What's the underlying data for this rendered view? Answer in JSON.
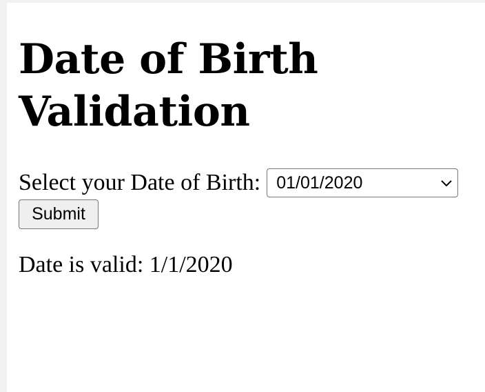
{
  "page": {
    "title": "Date of Birth Validation"
  },
  "form": {
    "dob_label": "Select your Date of Birth:",
    "dob_value": "01/01/2020",
    "submit_label": "Submit"
  },
  "result": {
    "message": "Date is valid: 1/1/2020"
  },
  "icons": {
    "dropdown": "chevron-down-icon"
  }
}
